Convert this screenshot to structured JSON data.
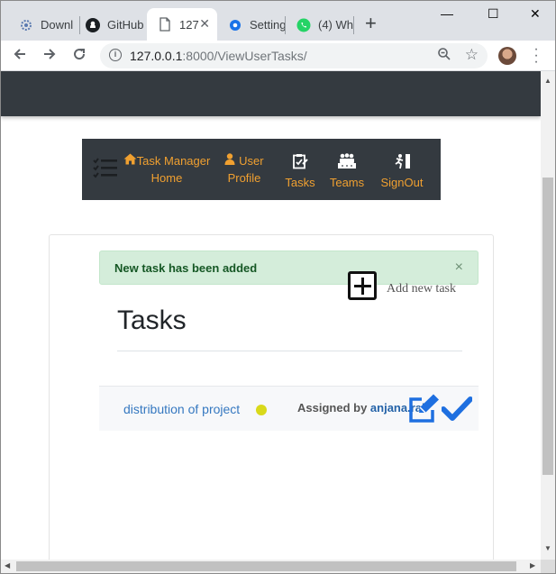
{
  "browser": {
    "tabs": [
      {
        "label": "Downl",
        "icon": "download-gear-icon",
        "active": false
      },
      {
        "label": "GitHub",
        "icon": "github-icon",
        "active": false
      },
      {
        "label": "127",
        "icon": "page-icon",
        "active": true
      },
      {
        "label": "Setting",
        "icon": "settings-gear-icon",
        "active": false
      },
      {
        "label": "(4) Wh",
        "icon": "whatsapp-icon",
        "active": false
      }
    ],
    "new_tab": "+",
    "window_controls": {
      "minimize": "—",
      "maximize": "☐",
      "close": "✕"
    },
    "address": {
      "host": "127.0.0.1",
      "rest": ":8000/ViewUserTasks/"
    }
  },
  "navbar": {
    "items": [
      {
        "line1": "Task Manager",
        "line2": "Home",
        "icon": "home-icon"
      },
      {
        "line1": "User",
        "line2": "Profile",
        "icon": "user-icon"
      },
      {
        "line1": "",
        "line2": "Tasks",
        "icon": "task-clipboard-icon"
      },
      {
        "line1": "",
        "line2": "Teams",
        "icon": "team-icon"
      },
      {
        "line1": "",
        "line2": "SignOut",
        "icon": "signout-icon"
      }
    ]
  },
  "alert": {
    "message": "New task has been added",
    "close": "×"
  },
  "add_task": {
    "label": "Add new task"
  },
  "page": {
    "title": "Tasks"
  },
  "tasks": [
    {
      "name": "distribution of project",
      "status_color": "#d9d91a",
      "assigned_prefix": "Assigned by",
      "assigned_by": "anjana.rai"
    }
  ],
  "colors": {
    "accent": "#f0a030",
    "navbar_bg": "#343a40",
    "alert_bg": "#d4edda",
    "link": "#3578c0",
    "action_blue": "#1e6fe0"
  }
}
